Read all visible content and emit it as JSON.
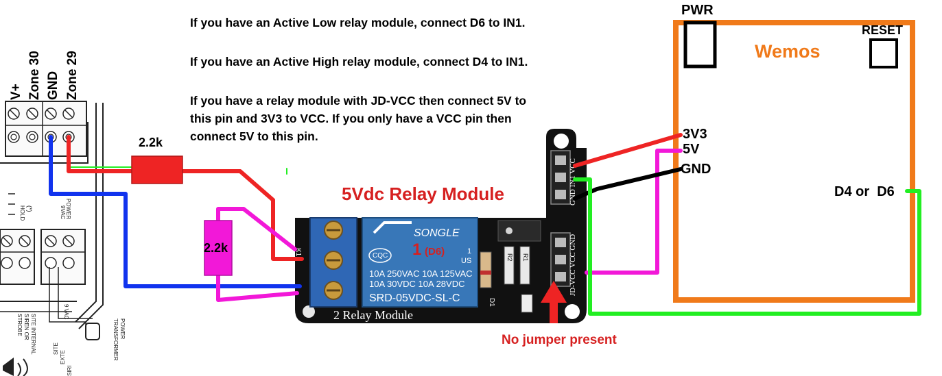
{
  "instructions": [
    "If you have an Active Low relay module, connect D6 to IN1.",
    "If you have an Active High relay module, connect D4 to IN1.",
    "If you have a relay module with JD-VCC then connect 5V to",
    "this pin and 3V3 to VCC. If you only have a VCC pin then",
    "connect 5V to this pin."
  ],
  "wemos": {
    "title": "Wemos",
    "pwr_label": "PWR",
    "reset_label": "RESET",
    "pins": {
      "v33": "3V3",
      "v5": "5V",
      "gnd": "GND",
      "data": "D4 or  D6"
    }
  },
  "relay": {
    "title": "5Vdc Relay Module",
    "bottom_text": "2 Relay Module",
    "channel_label": "1",
    "channel_pin": "(D6)",
    "relay_brand": "SONGLE",
    "relay_specs": [
      "10A 250VAC  10A 125VAC",
      "10A  30VDC  10A 28VDC"
    ],
    "relay_model": "SRD-05VDC-SL-C",
    "cqc": "CQC",
    "us": "US",
    "k1": "K1",
    "top_header": "GND IN1 VCC",
    "bottom_header": "JD-VCC VCC GND",
    "r1": "R1",
    "r2": "R2",
    "d1": "D1",
    "note": "No jumper present"
  },
  "resistors": {
    "top": "2.2k",
    "side": "2.2k"
  },
  "panel": {
    "terminal_labels": [
      "V+",
      "Zone 30",
      "GND",
      "Zone 29"
    ],
    "power_text": [
      "POWER",
      "9VAC"
    ],
    "hold_text": [
      "(*)",
      "HOLD"
    ],
    "bottom_texts": [
      "9 VAC",
      "SITE INTERNAL",
      "SIREN OR",
      "STROBE",
      "POWER",
      "TRANSFORMER",
      "SITE",
      "EXTE",
      "SIRI"
    ]
  },
  "colors": {
    "wemos_board": "#F07A1A",
    "wire_red": "#EE2424",
    "wire_blue": "#1133EE",
    "wire_magenta": "#F218D8",
    "wire_green": "#22EE22",
    "wire_black": "#000000",
    "relay_body": "#3877B8",
    "pcb": "#111111",
    "title_red": "#D62020"
  }
}
